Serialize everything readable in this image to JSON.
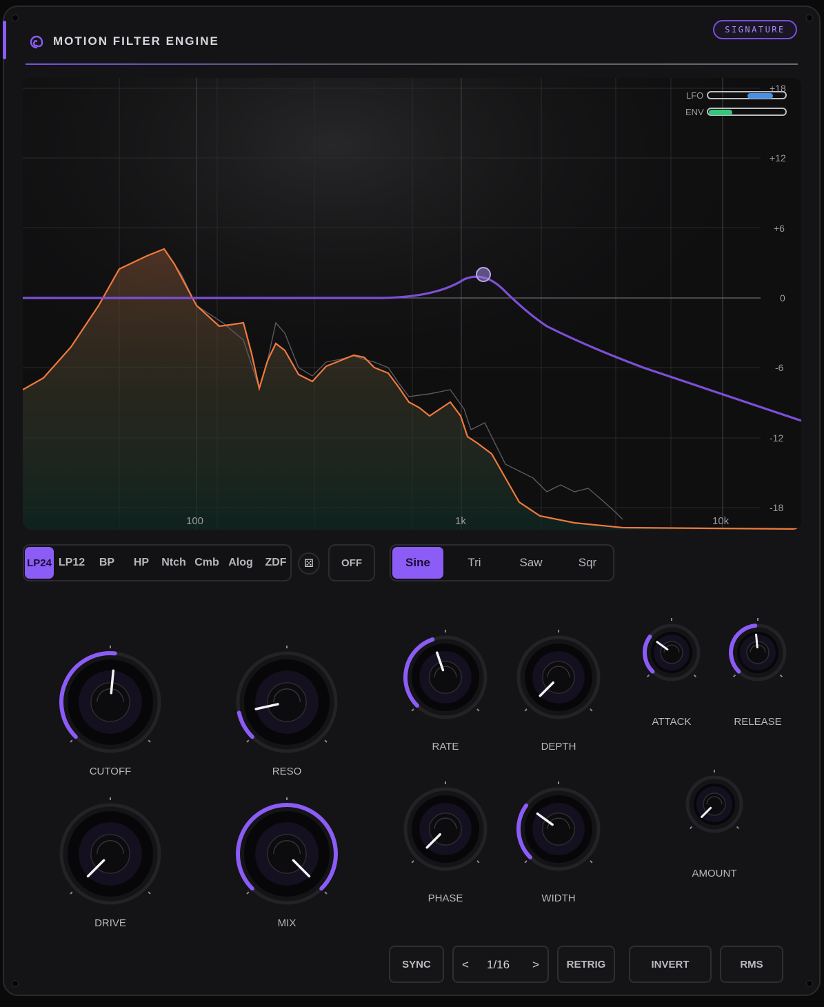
{
  "header": {
    "title": "MOTION FILTER ENGINE",
    "badge": "SIGNATURE"
  },
  "graph": {
    "db_labels": [
      "+18",
      "+12",
      "+6",
      "0",
      "-6",
      "-12",
      "-18"
    ],
    "freq_labels": [
      "100",
      "1k",
      "10k"
    ],
    "meters": [
      {
        "label": "LFO",
        "fill": 0.33,
        "color": "#4a90e2"
      },
      {
        "label": "ENV",
        "fill": 0.3,
        "color": "#34c77b"
      }
    ]
  },
  "filter_types": {
    "items": [
      "LP24",
      "LP12",
      "BP",
      "HP",
      "Ntch",
      "Cmb",
      "Alog",
      "ZDF"
    ],
    "selected": "LP24"
  },
  "dice_icon": "⚄",
  "off_label": "OFF",
  "lfo_shapes": {
    "items": [
      "Sine",
      "Tri",
      "Saw",
      "Sqr"
    ],
    "selected": "Sine"
  },
  "knobs": {
    "cutoff": {
      "label": "CUTOFF",
      "value": 0.52
    },
    "reso": {
      "label": "RESO",
      "value": 0.12
    },
    "drive": {
      "label": "DRIVE",
      "value": 0.0
    },
    "mix": {
      "label": "MIX",
      "value": 1.0
    },
    "rate": {
      "label": "RATE",
      "value": 0.43
    },
    "depth": {
      "label": "DEPTH",
      "value": 0.0
    },
    "phase": {
      "label": "PHASE",
      "value": 0.0
    },
    "width": {
      "label": "WIDTH",
      "value": 0.3
    },
    "attack": {
      "label": "ATTACK",
      "value": 0.3
    },
    "release": {
      "label": "RELEASE",
      "value": 0.48
    },
    "amount": {
      "label": "AMOUNT",
      "value": 0.0
    }
  },
  "footer": {
    "sync": "SYNC",
    "division": "1/16",
    "prev": "<",
    "next": ">",
    "retrig": "RETRIG",
    "invert": "INVERT",
    "rms": "RMS"
  }
}
